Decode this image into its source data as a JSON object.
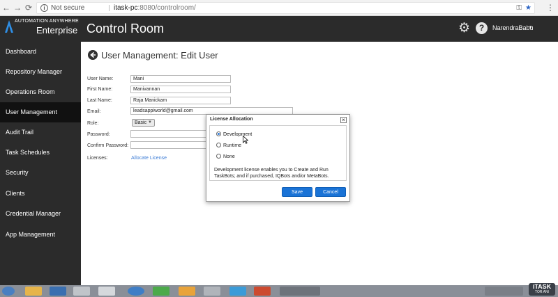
{
  "browser": {
    "security_label": "Not secure",
    "url_host": "itask-pc",
    "url_path": ":8080/controlroom/"
  },
  "header": {
    "logo_top": "AUTOMATION ANYWHERE",
    "logo_bottom": "Enterprise",
    "title": "Control Room",
    "user": "NarendraBabu",
    "user_caret": "▾"
  },
  "sidebar": {
    "items": [
      {
        "label": "Dashboard"
      },
      {
        "label": "Repository Manager"
      },
      {
        "label": "Operations Room"
      },
      {
        "label": "User Management"
      },
      {
        "label": "Audit Trail"
      },
      {
        "label": "Task Schedules"
      },
      {
        "label": "Security"
      },
      {
        "label": "Clients"
      },
      {
        "label": "Credential Manager"
      },
      {
        "label": "App Management"
      }
    ],
    "active_label": "User Management"
  },
  "page": {
    "title": "User Management: Edit User"
  },
  "form": {
    "user_name_label": "User Name:",
    "user_name_value": "Mani",
    "first_name_label": "First Name:",
    "first_name_value": "Manivannan",
    "last_name_label": "Last Name:",
    "last_name_value": "Raja Manickam",
    "email_label": "Email:",
    "email_value": "leadsappiworld@gmail.com",
    "role_label": "Role:",
    "role_value": "Basic",
    "password_label": "Password:",
    "confirm_password_label": "Confirm Password:",
    "licenses_label": "Licenses:",
    "license_link": "Allocate License"
  },
  "dialog": {
    "title": "License Allocation",
    "close": "×",
    "options": [
      {
        "label": "Development",
        "checked": true
      },
      {
        "label": "Runtime",
        "checked": false
      },
      {
        "label": "None",
        "checked": false
      }
    ],
    "description": "Development license enables you to Create and Run TaskBots; and if purchased, IQBots and/or MetaBots.",
    "save": "Save",
    "cancel": "Cancel"
  },
  "taskbar": {
    "brand_top": "iTASK",
    "brand_bottom": "TOR ANI"
  },
  "colors": {
    "header_bg": "#2b2b2b",
    "sidebar_active": "#111111",
    "accent_blue": "#1a73d6",
    "link_blue": "#3a7bd5"
  }
}
